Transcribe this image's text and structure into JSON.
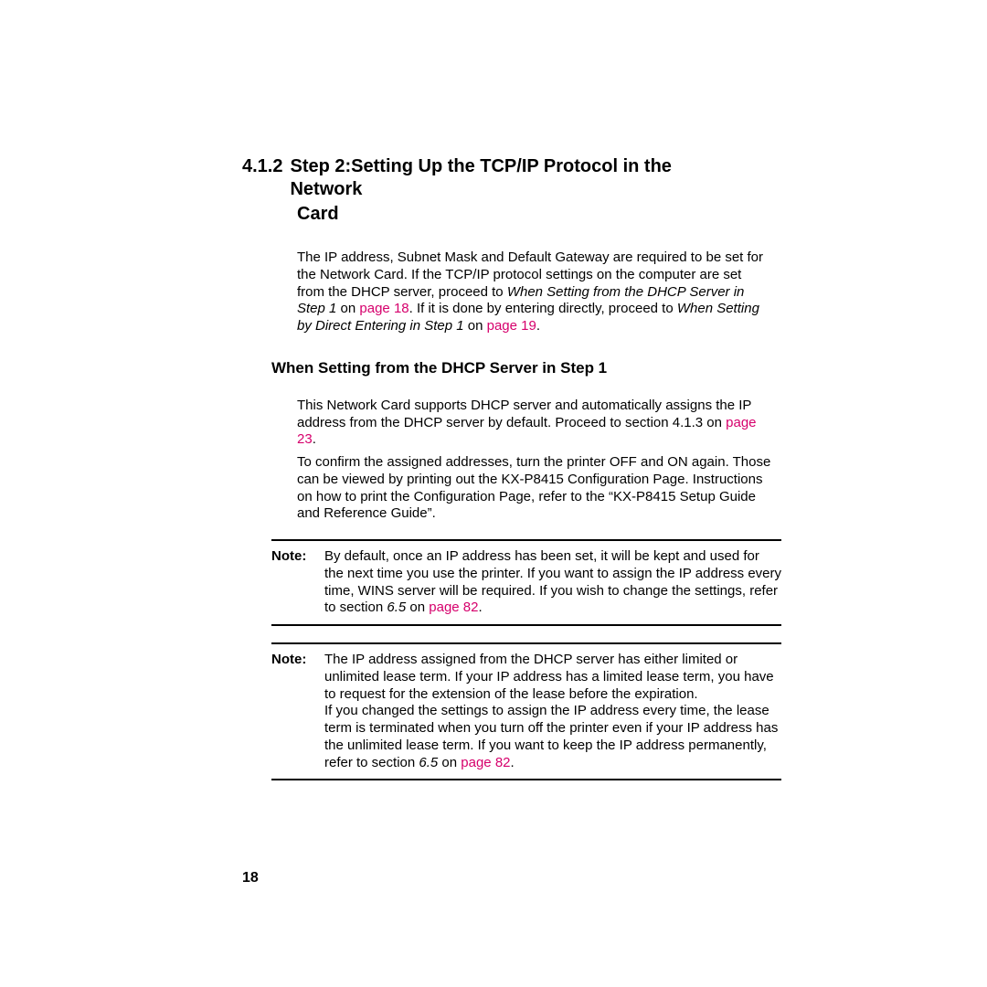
{
  "heading": {
    "number": "4.1.2",
    "title_line1": "Step 2:Setting Up the TCP/IP Protocol in the Network",
    "title_line2": "Card"
  },
  "intro": {
    "p1a": "The IP address, Subnet Mask and Default Gateway are required to be set for the Network Card. If the TCP/IP protocol settings on the computer are set from the DHCP server, proceed to ",
    "p1_italic1": "When Setting from the DHCP Server in Step 1",
    "p1b": " on ",
    "p1_link1": "page 18",
    "p1c": ". If it is done by entering directly, proceed to ",
    "p1_italic2": "When Setting by Direct Entering in Step 1",
    "p1d": " on ",
    "p1_link2": "page 19",
    "p1e": "."
  },
  "subhead": "When Setting from the DHCP Server in Step 1",
  "body": {
    "p2a": "This Network Card supports DHCP server and automatically assigns the IP address from the DHCP server by default. Proceed to section ",
    "p2_italic": "4.1.3",
    "p2b": " on ",
    "p2_link": "page 23",
    "p2c": ".",
    "p3": "To confirm the assigned addresses, turn the printer OFF and ON again. Those can be viewed by printing out the KX-P8415 Configuration Page. Instructions on how to print the Configuration Page, refer to the “KX-P8415 Setup Guide and Reference Guide”."
  },
  "note1": {
    "label": "Note:",
    "t1": "By default, once an IP address has been set, it will be kept and used for the next time you use the printer. If you want to assign the IP address every time, WINS server will be required. If you wish to change the settings, refer to section ",
    "italic": "6.5",
    "t2": " on ",
    "link": "page 82",
    "t3": "."
  },
  "note2": {
    "label": "Note:",
    "t1": "The IP address assigned from the DHCP server has either limited or unlimited lease term. If your IP address has a limited lease term, you have to request for the extension of the lease before the expiration.",
    "t2a": "If you changed the settings to assign the IP address every time, the lease term is terminated when you turn off the printer even if your IP address has the unlimited lease term. If you want to keep the IP address permanently, refer to section ",
    "italic": "6.5",
    "t2b": " on ",
    "link": "page 82",
    "t2c": "."
  },
  "page_number": "18"
}
